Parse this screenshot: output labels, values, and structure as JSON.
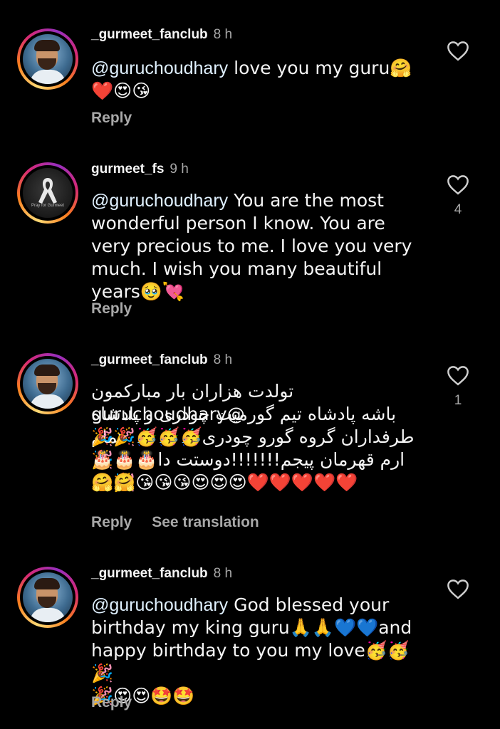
{
  "comments": [
    {
      "username": "_gurmeet_fanclub",
      "time": "8 h",
      "mention": "@guruchoudhary",
      "text": " love you my guru🤗",
      "text2": "❤️😍😘",
      "reply": "Reply",
      "like_count": ""
    },
    {
      "username": "gurmeet_fs",
      "time": "9 h",
      "mention": "@guruchoudhary",
      "text": " You are the most wonderful person I know. You are very precious to me. I love you very much. I wish you many beautiful years🥹💘",
      "reply": "Reply",
      "like_count": "4",
      "avatar_caption": "Pray for Gurmeet"
    },
    {
      "username": "_gurmeet_fanclub",
      "time": "8 h",
      "line1": "تولدت هزاران بار مبارکمون @guruchoudhary",
      "line2": "باشه پادشاه تیم گورمیت چودری و پادشاه تمام",
      "line3": "طرفداران گروه گورو چودری🥳🥳🥳🎉🎉🎉",
      "line4": "ارم قهرمان پیجم!!!!!!!دوستت دا🎂🎂🎂🎉🤗",
      "line5": "🤗🤗😘😘😘😍😍😍❤️❤️❤️❤️❤️",
      "reply": "Reply",
      "see_translation": "See translation",
      "like_count": "1"
    },
    {
      "username": "_gurmeet_fanclub",
      "time": "8 h",
      "mention": "@guruchoudhary",
      "text": " God blessed your birthday my king guru🙏🙏💙💙and happy birthday to you my love🥳🥳🎉",
      "text2": "🎉😍😍🤩🤩",
      "reply": "Reply",
      "like_count": ""
    }
  ]
}
